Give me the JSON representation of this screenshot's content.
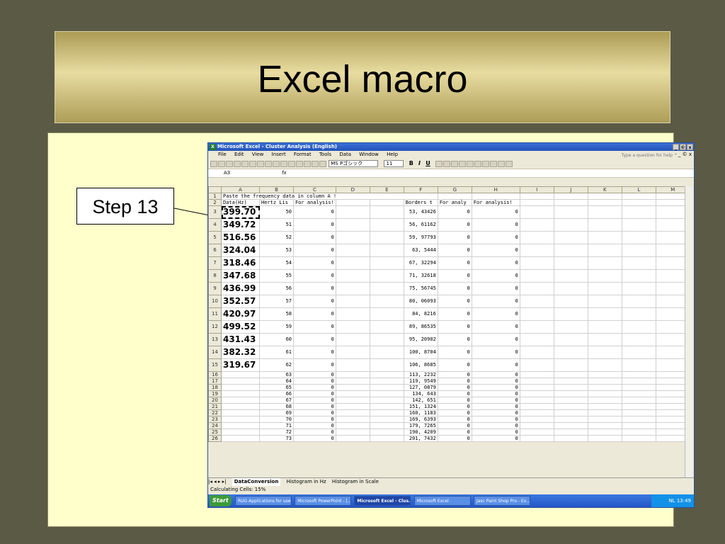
{
  "slide": {
    "title": "Excel macro",
    "callout": "Step 13"
  },
  "window": {
    "title": "Microsoft Excel - Cluster Analysis (English)",
    "buttons": [
      "_",
      "©",
      "x"
    ]
  },
  "menu": {
    "items": [
      "File",
      "Edit",
      "View",
      "Insert",
      "Format",
      "Tools",
      "Data",
      "Window",
      "Help"
    ],
    "help_placeholder": "Type a question for help",
    "right": "- _ © x"
  },
  "toolbar": {
    "font": "MS Pゴシック",
    "size": "11",
    "bold": "B",
    "italic": "I",
    "underline": "U"
  },
  "formula_bar": {
    "cell_ref": "A3",
    "fx": "fx"
  },
  "columns": [
    "A",
    "B",
    "C",
    "D",
    "E",
    "F",
    "G",
    "H",
    "I",
    "J",
    "K",
    "L",
    "M"
  ],
  "rows": [
    {
      "n": "1",
      "a": "Paste the frequency data in column A !",
      "b": "",
      "c": "",
      "f": "",
      "g": "",
      "h": ""
    },
    {
      "n": "2",
      "a": "Data(Hz)",
      "b": "Hertz Lis",
      "c": "For analysis!",
      "f": "Borders t",
      "g": "For analy",
      "h": "For analysis!"
    },
    {
      "n": "3",
      "a": "399.70",
      "b": "50",
      "c": "0",
      "f": "53, 43426",
      "g": "0",
      "h": "0"
    },
    {
      "n": "4",
      "a": "349.72",
      "b": "51",
      "c": "0",
      "f": "56, 61162",
      "g": "0",
      "h": "0"
    },
    {
      "n": "5",
      "a": "516.56",
      "b": "52",
      "c": "0",
      "f": "59, 97793",
      "g": "0",
      "h": "0"
    },
    {
      "n": "6",
      "a": "324.04",
      "b": "53",
      "c": "0",
      "f": "63, 5444",
      "g": "0",
      "h": "0"
    },
    {
      "n": "7",
      "a": "318.46",
      "b": "54",
      "c": "0",
      "f": "67, 32294",
      "g": "0",
      "h": "0"
    },
    {
      "n": "8",
      "a": "347.68",
      "b": "55",
      "c": "0",
      "f": "71, 32618",
      "g": "0",
      "h": "0"
    },
    {
      "n": "9",
      "a": "436.99",
      "b": "56",
      "c": "0",
      "f": "75, 56745",
      "g": "0",
      "h": "0"
    },
    {
      "n": "10",
      "a": "352.57",
      "b": "57",
      "c": "0",
      "f": "80, 06093",
      "g": "0",
      "h": "0"
    },
    {
      "n": "11",
      "a": "420.97",
      "b": "58",
      "c": "0",
      "f": "84, 8216",
      "g": "0",
      "h": "0"
    },
    {
      "n": "12",
      "a": "499.52",
      "b": "59",
      "c": "0",
      "f": "89, 86535",
      "g": "0",
      "h": "0"
    },
    {
      "n": "13",
      "a": "431.43",
      "b": "60",
      "c": "0",
      "f": "95, 20902",
      "g": "0",
      "h": "0"
    },
    {
      "n": "14",
      "a": "382.32",
      "b": "61",
      "c": "0",
      "f": "100, 8704",
      "g": "0",
      "h": "0"
    },
    {
      "n": "15",
      "a": "319.67",
      "b": "62",
      "c": "0",
      "f": "106, 8685",
      "g": "0",
      "h": "0"
    },
    {
      "n": "16",
      "a": "",
      "b": "63",
      "c": "0",
      "f": "113, 2232",
      "g": "0",
      "h": "0"
    },
    {
      "n": "17",
      "a": "",
      "b": "64",
      "c": "0",
      "f": "119, 9549",
      "g": "0",
      "h": "0"
    },
    {
      "n": "18",
      "a": "",
      "b": "65",
      "c": "0",
      "f": "127, 0879",
      "g": "0",
      "h": "0"
    },
    {
      "n": "19",
      "a": "",
      "b": "66",
      "c": "0",
      "f": "134, 643",
      "g": "0",
      "h": "0"
    },
    {
      "n": "20",
      "a": "",
      "b": "67",
      "c": "0",
      "f": "142, 651",
      "g": "0",
      "h": "0"
    },
    {
      "n": "21",
      "a": "",
      "b": "68",
      "c": "0",
      "f": "151, 1324",
      "g": "0",
      "h": "0"
    },
    {
      "n": "22",
      "a": "",
      "b": "69",
      "c": "0",
      "f": "160, 1183",
      "g": "0",
      "h": "0"
    },
    {
      "n": "23",
      "a": "",
      "b": "70",
      "c": "0",
      "f": "169, 6393",
      "g": "0",
      "h": "0"
    },
    {
      "n": "24",
      "a": "",
      "b": "71",
      "c": "0",
      "f": "179, 7265",
      "g": "0",
      "h": "0"
    },
    {
      "n": "25",
      "a": "",
      "b": "72",
      "c": "0",
      "f": "190, 4209",
      "g": "0",
      "h": "0"
    },
    {
      "n": "26",
      "a": "",
      "b": "73",
      "c": "0",
      "f": "201, 7432",
      "g": "0",
      "h": "0"
    }
  ],
  "sheet_tabs": [
    "DataConversion",
    "Histogram in Hz",
    "Histogram in Scale"
  ],
  "status": "Calculating Cells: 15%",
  "taskbar": {
    "start": "Start",
    "tasks": [
      "RUG Applications for use...",
      "Microsoft PowerPoint - [...",
      "Microsoft Excel - Clus...",
      "Microsoft Excel",
      "Jasc Paint Shop Pro - Ex..."
    ],
    "lang": "NL",
    "clock": "13:49"
  }
}
